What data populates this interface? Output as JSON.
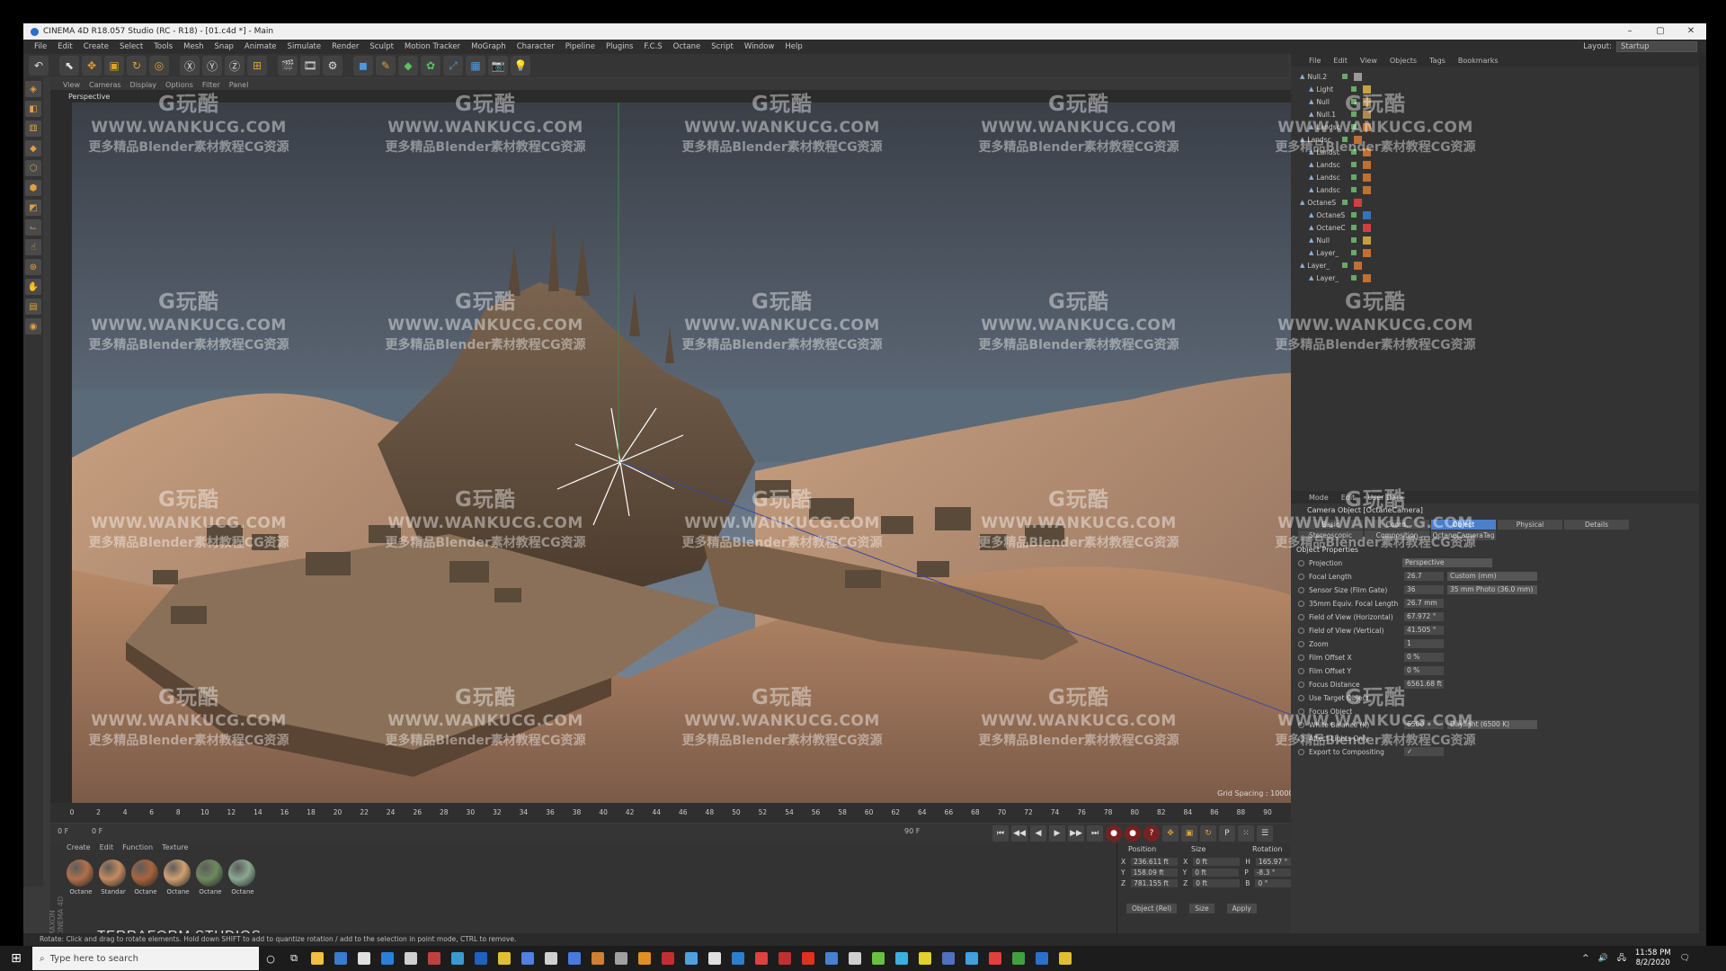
{
  "window": {
    "title": "CINEMA 4D R18.057 Studio (RC - R18) - [01.c4d *] - Main",
    "controls": [
      "–",
      "▢",
      "✕"
    ]
  },
  "menubar": {
    "items": [
      "File",
      "Edit",
      "Create",
      "Select",
      "Tools",
      "Mesh",
      "Snap",
      "Animate",
      "Simulate",
      "Render",
      "Sculpt",
      "Motion Tracker",
      "MoGraph",
      "Character",
      "Pipeline",
      "Plugins",
      "F.C.S",
      "Octane",
      "Script",
      "Window",
      "Help"
    ],
    "layout_label": "Layout:",
    "layout_value": "Startup"
  },
  "viewport": {
    "menu": [
      "View",
      "Cameras",
      "Display",
      "Options",
      "Filter",
      "Panel"
    ],
    "label": "Perspective",
    "grid_spacing": "Grid Spacing : 100000 ft"
  },
  "timeline": {
    "ticks": [
      "0",
      "2",
      "4",
      "6",
      "8",
      "10",
      "12",
      "14",
      "16",
      "18",
      "20",
      "22",
      "24",
      "26",
      "28",
      "30",
      "32",
      "34",
      "36",
      "38",
      "40",
      "42",
      "44",
      "46",
      "48",
      "50",
      "52",
      "54",
      "56",
      "58",
      "60",
      "62",
      "64",
      "66",
      "68",
      "70",
      "72",
      "74",
      "76",
      "78",
      "80",
      "82",
      "84",
      "86",
      "88",
      "90"
    ],
    "end_frame": "0 F",
    "start_field": "0 F",
    "min_field": "0 F",
    "max_field": "90 F"
  },
  "materials": {
    "menu": [
      "Create",
      "Edit",
      "Function",
      "Texture"
    ],
    "items": [
      {
        "label": "Octane",
        "color": "#b0704a"
      },
      {
        "label": "Standar",
        "color": "#c48a60"
      },
      {
        "label": "Octane",
        "color": "#a8643c"
      },
      {
        "label": "Octane",
        "color": "#d0a070"
      },
      {
        "label": "Octane",
        "color": "#6e8a60"
      },
      {
        "label": "Octane",
        "color": "#8aa890"
      }
    ]
  },
  "studio_text": "TERRAFORM STUDIOS",
  "c4d_logo": "MAXON CINEMA 4D",
  "coordinates": {
    "headers": [
      "Position",
      "Size",
      "Rotation"
    ],
    "rows": [
      {
        "axis": "X",
        "pos": "236.611 ft",
        "size_axis": "X",
        "size": "0 ft",
        "rot_axis": "H",
        "rot": "165.97 °"
      },
      {
        "axis": "Y",
        "pos": "158.09 ft",
        "size_axis": "Y",
        "size": "0 ft",
        "rot_axis": "P",
        "rot": "-8.3 °"
      },
      {
        "axis": "Z",
        "pos": "781.155 ft",
        "size_axis": "Z",
        "size": "0 ft",
        "rot_axis": "B",
        "rot": "0 °"
      }
    ],
    "mode": "Object (Rel)",
    "size_mode": "Size",
    "apply": "Apply"
  },
  "status": "Rotate: Click and drag to rotate elements. Hold down SHIFT to add to quantize rotation / add to the selection in point mode, CTRL to remove.",
  "object_manager": {
    "menu": [
      "File",
      "Edit",
      "View",
      "Objects",
      "Tags",
      "Bookmarks"
    ],
    "rows": [
      {
        "name": "Null.2",
        "tag": "#9a9a9a"
      },
      {
        "name": "Light",
        "tag": "#c8a040"
      },
      {
        "name": "Null",
        "tag": "#b08a50"
      },
      {
        "name": "Null.1",
        "tag": "#b08a50"
      },
      {
        "name": "Landsc",
        "tag": "#c07030"
      },
      {
        "name": "Landsc",
        "tag": "#c07030"
      },
      {
        "name": "Landsc",
        "tag": "#c07030"
      },
      {
        "name": "Landsc",
        "tag": "#c07030"
      },
      {
        "name": "Landsc",
        "tag": "#c07030"
      },
      {
        "name": "Landsc",
        "tag": "#c07030"
      },
      {
        "name": "OctaneS",
        "tag": "#d04040"
      },
      {
        "name": "OctaneS",
        "tag": "#3a70c0"
      },
      {
        "name": "OctaneC",
        "tag": "#d04040"
      },
      {
        "name": "Null",
        "tag": "#c8a040"
      },
      {
        "name": "Layer_",
        "tag": "#c07030"
      },
      {
        "name": "Layer_",
        "tag": "#c07030"
      },
      {
        "name": "Layer_",
        "tag": "#c07030"
      }
    ]
  },
  "attributes": {
    "menu": [
      "Mode",
      "Edit",
      "User Data"
    ],
    "title": "Camera Object [OctaneCamera]",
    "tabs_row1": [
      "Basic",
      "Coord.",
      "Object",
      "Physical",
      "Details"
    ],
    "tabs_row2": [
      "Stereoscopic",
      "Composition",
      "OctaneCameraTag"
    ],
    "active_tab": "Object",
    "section": "Object Properties",
    "rows": [
      {
        "label": "Projection",
        "value": "",
        "select": "Perspective"
      },
      {
        "label": "Focal Length",
        "value": "26.7",
        "select": "Custom (mm)"
      },
      {
        "label": "Sensor Size (Film Gate)",
        "value": "36",
        "select": "35 mm Photo (36.0 mm)"
      },
      {
        "label": "35mm Equiv. Focal Length:",
        "value": "26.7 mm",
        "select": ""
      },
      {
        "label": "Field of View (Horizontal)",
        "value": "67.972 °",
        "select": ""
      },
      {
        "label": "Field of View (Vertical)",
        "value": "41.505 °",
        "select": ""
      },
      {
        "label": "Zoom",
        "value": "1",
        "select": ""
      },
      {
        "label": "Film Offset X",
        "value": "0 %",
        "select": ""
      },
      {
        "label": "Film Offset Y",
        "value": "0 %",
        "select": ""
      },
      {
        "label": "Focus Distance",
        "value": "6561.68 ft",
        "select": ""
      },
      {
        "label": "Use Target Object",
        "value": "",
        "select": ""
      },
      {
        "label": "Focus Object",
        "value": "",
        "select": ""
      },
      {
        "label": "White Balance (K)",
        "value": "6500",
        "select": "Daylight (6500 K)"
      },
      {
        "label": "Affect Lights Only",
        "value": "",
        "select": ""
      },
      {
        "label": "Export to Compositing",
        "value": "✓",
        "select": ""
      }
    ]
  },
  "taskbar": {
    "search_placeholder": "Type here to search",
    "time": "11:58 PM",
    "date": "8/2/2020",
    "apps": [
      "#f0c040",
      "#3a7ad0",
      "#e0e0e0",
      "#2a80d8",
      "#d0d0d0",
      "#c04040",
      "#3a9ad0",
      "#2060c0",
      "#e0c030",
      "#5080e0",
      "#d0d0d0",
      "#4a7ae0",
      "#d08030",
      "#a0a0a0",
      "#e09020",
      "#c03030",
      "#50a0e0",
      "#e0e0e0",
      "#2a80d0",
      "#e04040",
      "#c03030",
      "#e03020",
      "#4a80d0",
      "#d0d0d0",
      "#6ac040",
      "#3ab0e0",
      "#e0d030",
      "#5070c0",
      "#40a0e0",
      "#e04040",
      "#40a040",
      "#2a70d0",
      "#e0c030"
    ]
  },
  "watermark": {
    "line1": "G玩酷",
    "line2": "WWW.WANKUCG.COM",
    "line3": "更多精品Blender素材教程CG资源"
  }
}
